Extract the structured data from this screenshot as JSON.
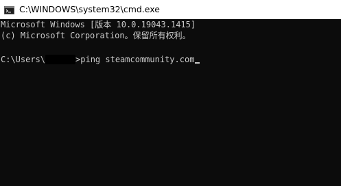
{
  "window": {
    "title": "C:\\WINDOWS\\system32\\cmd.exe",
    "icon": "cmd-console-icon"
  },
  "console": {
    "line1": "Microsoft Windows [版本 10.0.19043.1415]",
    "line2": "(c) Microsoft Corporation。保留所有权利。",
    "prompt_prefix": "C:\\Users\\",
    "prompt_suffix": ">ping steamcommunity.com"
  },
  "colors": {
    "console_background": "#0c0c0c",
    "console_text": "#cccccc",
    "titlebar_background": "#ffffff"
  }
}
